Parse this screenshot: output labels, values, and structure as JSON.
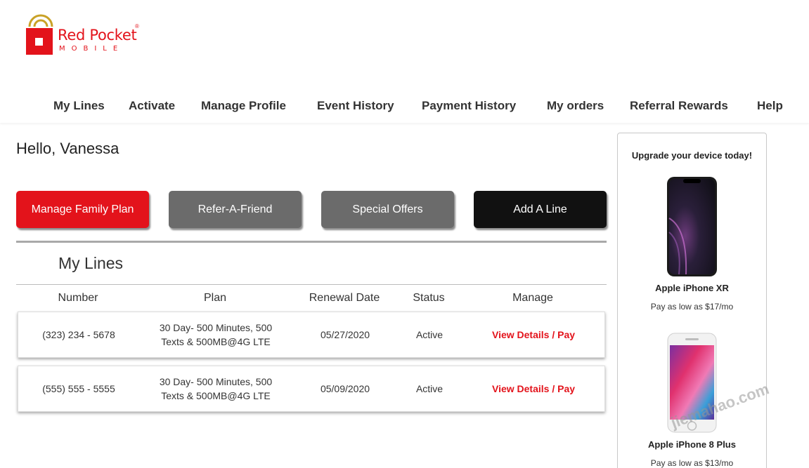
{
  "brand": {
    "name": "Red Pocket",
    "sub": "MOBILE",
    "reg": "®",
    "color": "#e3131b"
  },
  "nav": [
    {
      "label": "My Lines"
    },
    {
      "label": "Activate"
    },
    {
      "label": "Manage Profile"
    },
    {
      "label": "Event History"
    },
    {
      "label": "Payment History"
    },
    {
      "label": "My orders"
    },
    {
      "label": "Referral Rewards"
    },
    {
      "label": "Help"
    }
  ],
  "greeting": "Hello, Vanessa",
  "actions": {
    "manage_family_plan": "Manage Family Plan",
    "refer_a_friend": "Refer-A-Friend",
    "special_offers": "Special Offers",
    "add_a_line": "Add A Line"
  },
  "my_lines": {
    "title": "My Lines",
    "columns": [
      "Number",
      "Plan",
      "Renewal Date",
      "Status",
      "Manage"
    ],
    "rows": [
      {
        "number": "(323) 234 - 5678",
        "plan": "30 Day- 500 Minutes, 500 Texts & 500MB@4G LTE",
        "renewal": "05/27/2020",
        "status": "Active",
        "manage": "View Details / Pay"
      },
      {
        "number": "(555) 555 - 5555",
        "plan": "30 Day- 500 Minutes, 500 Texts & 500MB@4G LTE",
        "renewal": "05/09/2020",
        "status": "Active",
        "manage": "View Details / Pay"
      }
    ]
  },
  "sidebar": {
    "title": "Upgrade your device today!",
    "devices": [
      {
        "name": "Apple iPhone XR",
        "price": "Pay as low as $17/mo"
      },
      {
        "name": "Apple iPhone 8 Plus",
        "price": "Pay as low as $13/mo"
      }
    ]
  },
  "watermark": "jiemahao.com"
}
